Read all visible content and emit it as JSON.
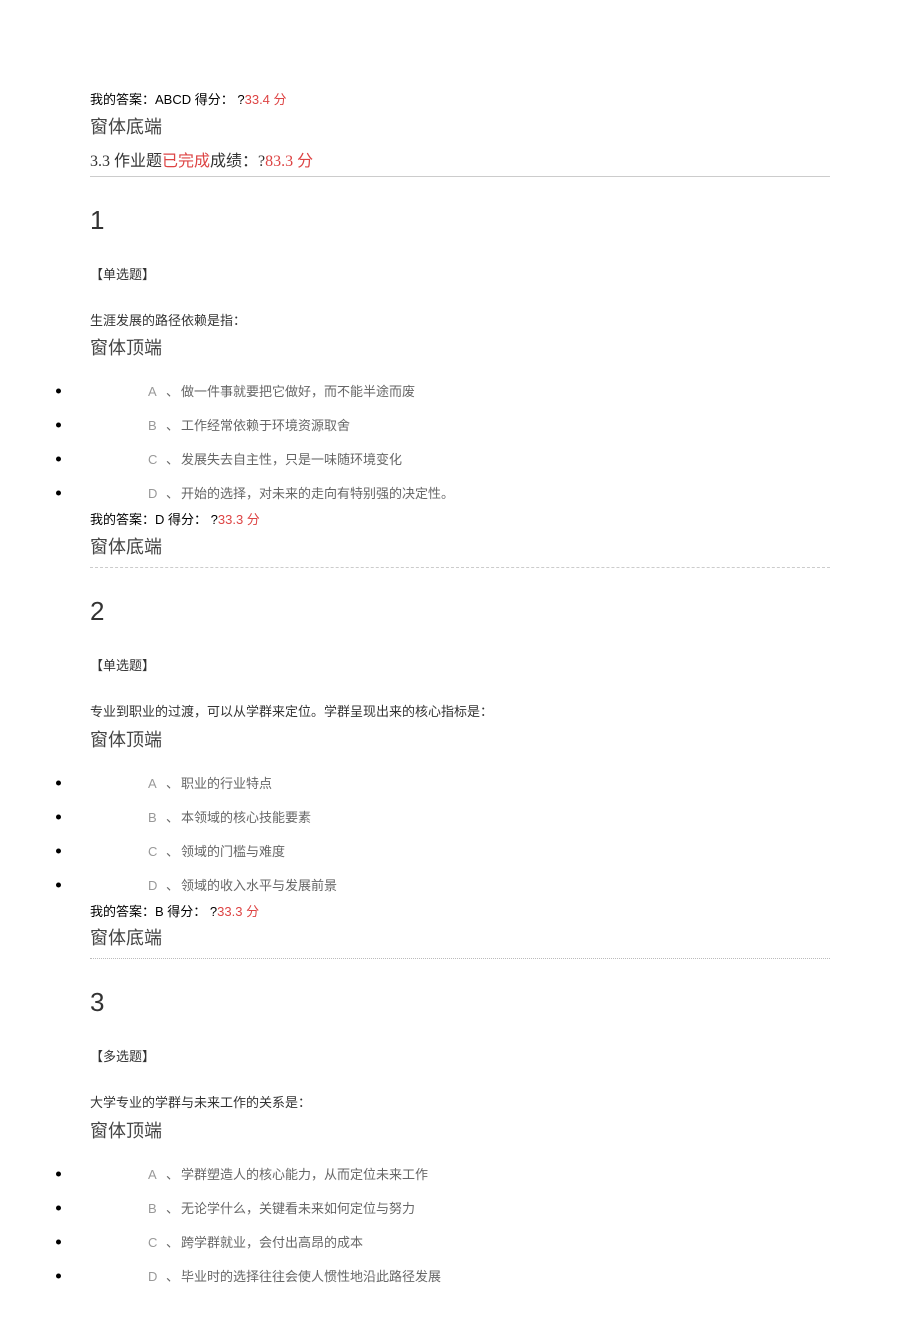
{
  "top_answer": {
    "label": "我的答案：",
    "value": "ABCD",
    "score_label": " 得分： ?",
    "score_value": "33.4 分"
  },
  "form_footer": "窗体底端",
  "form_top": "窗体顶端",
  "assignment": {
    "title": "3.3 作业题",
    "done": "已完成",
    "grade_label": "成绩：?",
    "grade_value": "83.3 分"
  },
  "questions": [
    {
      "num": "1",
      "type": "【单选题】",
      "text": "生涯发展的路径依赖是指：",
      "options": [
        {
          "letter": "A",
          "text": "做一件事就要把它做好，而不能半途而废"
        },
        {
          "letter": "B",
          "text": "工作经常依赖于环境资源取舍"
        },
        {
          "letter": "C",
          "text": "发展失去自主性，只是一味随环境变化"
        },
        {
          "letter": "D",
          "text": "开始的选择，对未来的走向有特别强的决定性。"
        }
      ],
      "answer": {
        "label": "我的答案：",
        "value": "D",
        "score_label": " 得分： ?",
        "score_value": "33.3 分"
      },
      "divider": "dashed"
    },
    {
      "num": "2",
      "type": "【单选题】",
      "text": "专业到职业的过渡，可以从学群来定位。学群呈现出来的核心指标是：",
      "options": [
        {
          "letter": "A",
          "text": "职业的行业特点"
        },
        {
          "letter": "B",
          "text": "本领域的核心技能要素"
        },
        {
          "letter": "C",
          "text": "领域的门槛与难度"
        },
        {
          "letter": "D",
          "text": "领域的收入水平与发展前景"
        }
      ],
      "answer": {
        "label": "我的答案：",
        "value": "B",
        "score_label": " 得分： ?",
        "score_value": "33.3 分"
      },
      "divider": "dotted"
    },
    {
      "num": "3",
      "type": "【多选题】",
      "text": "大学专业的学群与未来工作的关系是：",
      "options": [
        {
          "letter": "A",
          "text": "学群塑造人的核心能力，从而定位未来工作"
        },
        {
          "letter": "B",
          "text": "无论学什么，关键看未来如何定位与努力"
        },
        {
          "letter": "C",
          "text": "跨学群就业，会付出高昂的成本"
        },
        {
          "letter": "D",
          "text": "毕业时的选择往往会使人惯性地沿此路径发展"
        }
      ]
    }
  ]
}
